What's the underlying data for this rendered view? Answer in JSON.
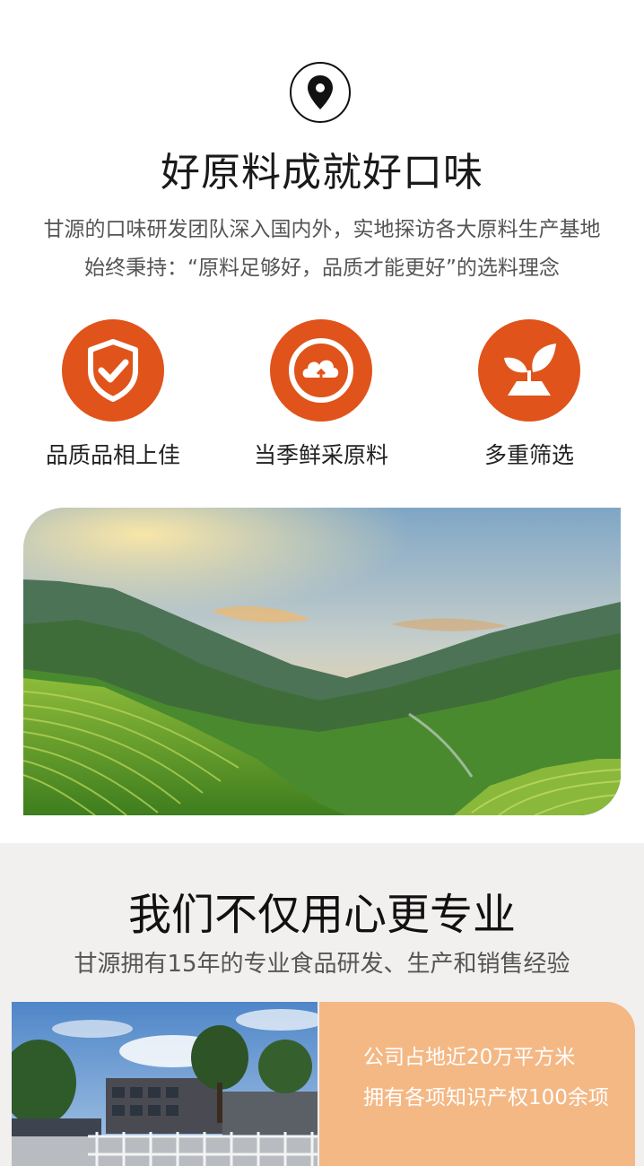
{
  "ingredients": {
    "icon": "location-pin-icon",
    "title": "好原料成就好口味",
    "desc_line1": "甘源的口味研发团队深入国内外，实地探访各大原料生产基地",
    "desc_line2": "始终秉持：“原料足够好，品质才能更好”的选料理念",
    "features": [
      {
        "icon": "shield-check-icon",
        "label": "品质品相上佳"
      },
      {
        "icon": "cloud-badge-icon",
        "label": "当季鲜采原料"
      },
      {
        "icon": "leaf-icon",
        "label": "多重筛选"
      }
    ],
    "accent": "#e0531a",
    "image": "rice-terrace-landscape-photo"
  },
  "professional": {
    "title": "我们不仅用心更专业",
    "subtitle": "甘源拥有15年的专业食品研发、生产和销售经验",
    "image": "factory-building-photo",
    "stats": [
      "公司占地近20万平方米",
      "拥有各项知识产权100余项"
    ],
    "stats_bg": "#f4b885"
  }
}
